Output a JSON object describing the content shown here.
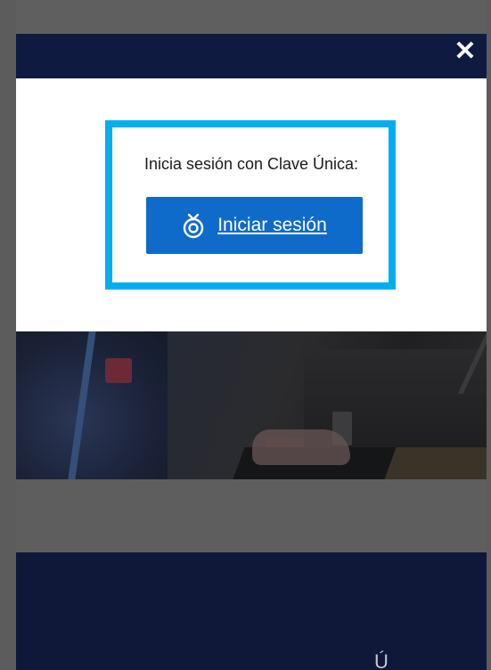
{
  "modal": {
    "title": "Inicia sesión con Clave Única:",
    "login_button_label": "Iniciar sesión",
    "close_label": "✕"
  },
  "footer": {
    "partial_glyph": "Ú"
  },
  "colors": {
    "highlight_border": "#00aeef",
    "button_bg": "#0f6bc9",
    "header_bg": "#0f1a40",
    "footer_bg": "#0f1838"
  },
  "icons": {
    "close": "close-icon",
    "clave_unica": "clave-unica-icon"
  }
}
